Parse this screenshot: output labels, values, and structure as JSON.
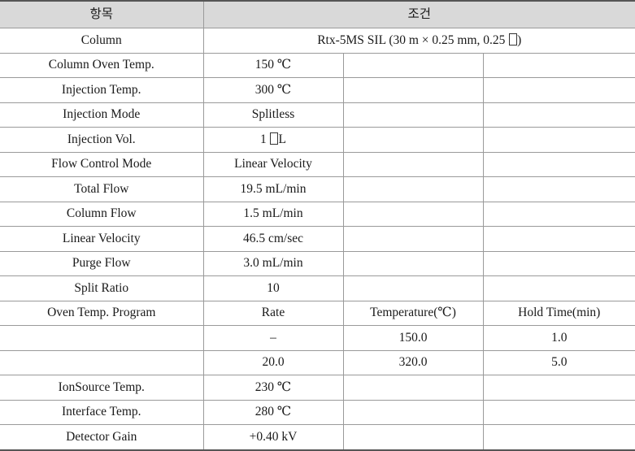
{
  "table": {
    "headers": {
      "item": "항목",
      "condition": "조건"
    },
    "program_subheaders": {
      "rate": "Rate",
      "temperature": "Temperature(℃)",
      "hold_time": "Hold Time(min)"
    },
    "rows": [
      {
        "label": "Column",
        "value": "Rtx-5MS SIL (30 m × 0.25 mm, 0.25 ㎛)",
        "merged": true
      },
      {
        "label": "Column Oven Temp.",
        "value": "150 ℃",
        "merged": false
      },
      {
        "label": "Injection Temp.",
        "value": "300 ℃",
        "merged": false
      },
      {
        "label": "Injection Mode",
        "value": "Splitless",
        "merged": false
      },
      {
        "label": "Injection Vol.",
        "value": "1 ㎕L",
        "merged": false
      },
      {
        "label": "Flow Control Mode",
        "value": "Linear Velocity",
        "merged": false
      },
      {
        "label": "Total Flow",
        "value": "19.5 mL/min",
        "merged": false
      },
      {
        "label": "Column Flow",
        "value": "1.5 mL/min",
        "merged": false
      },
      {
        "label": "Linear Velocity",
        "value": "46.5 cm/sec",
        "merged": false
      },
      {
        "label": "Purge Flow",
        "value": "3.0 mL/min",
        "merged": false
      },
      {
        "label": "Split Ratio",
        "value": "10",
        "merged": false
      }
    ],
    "program": {
      "label": "Oven Temp. Program",
      "steps": [
        {
          "label": "",
          "rate": "–",
          "temperature": "150.0",
          "hold_time": "1.0"
        },
        {
          "label": "",
          "rate": "20.0",
          "temperature": "320.0",
          "hold_time": "5.0"
        }
      ]
    },
    "rows_tail": [
      {
        "label": "IonSource Temp.",
        "value": "230 ℃",
        "merged": false
      },
      {
        "label": "Interface Temp.",
        "value": "280 ℃",
        "merged": false
      },
      {
        "label": "Detector Gain",
        "value": "+0.40 kV",
        "merged": false
      }
    ]
  }
}
